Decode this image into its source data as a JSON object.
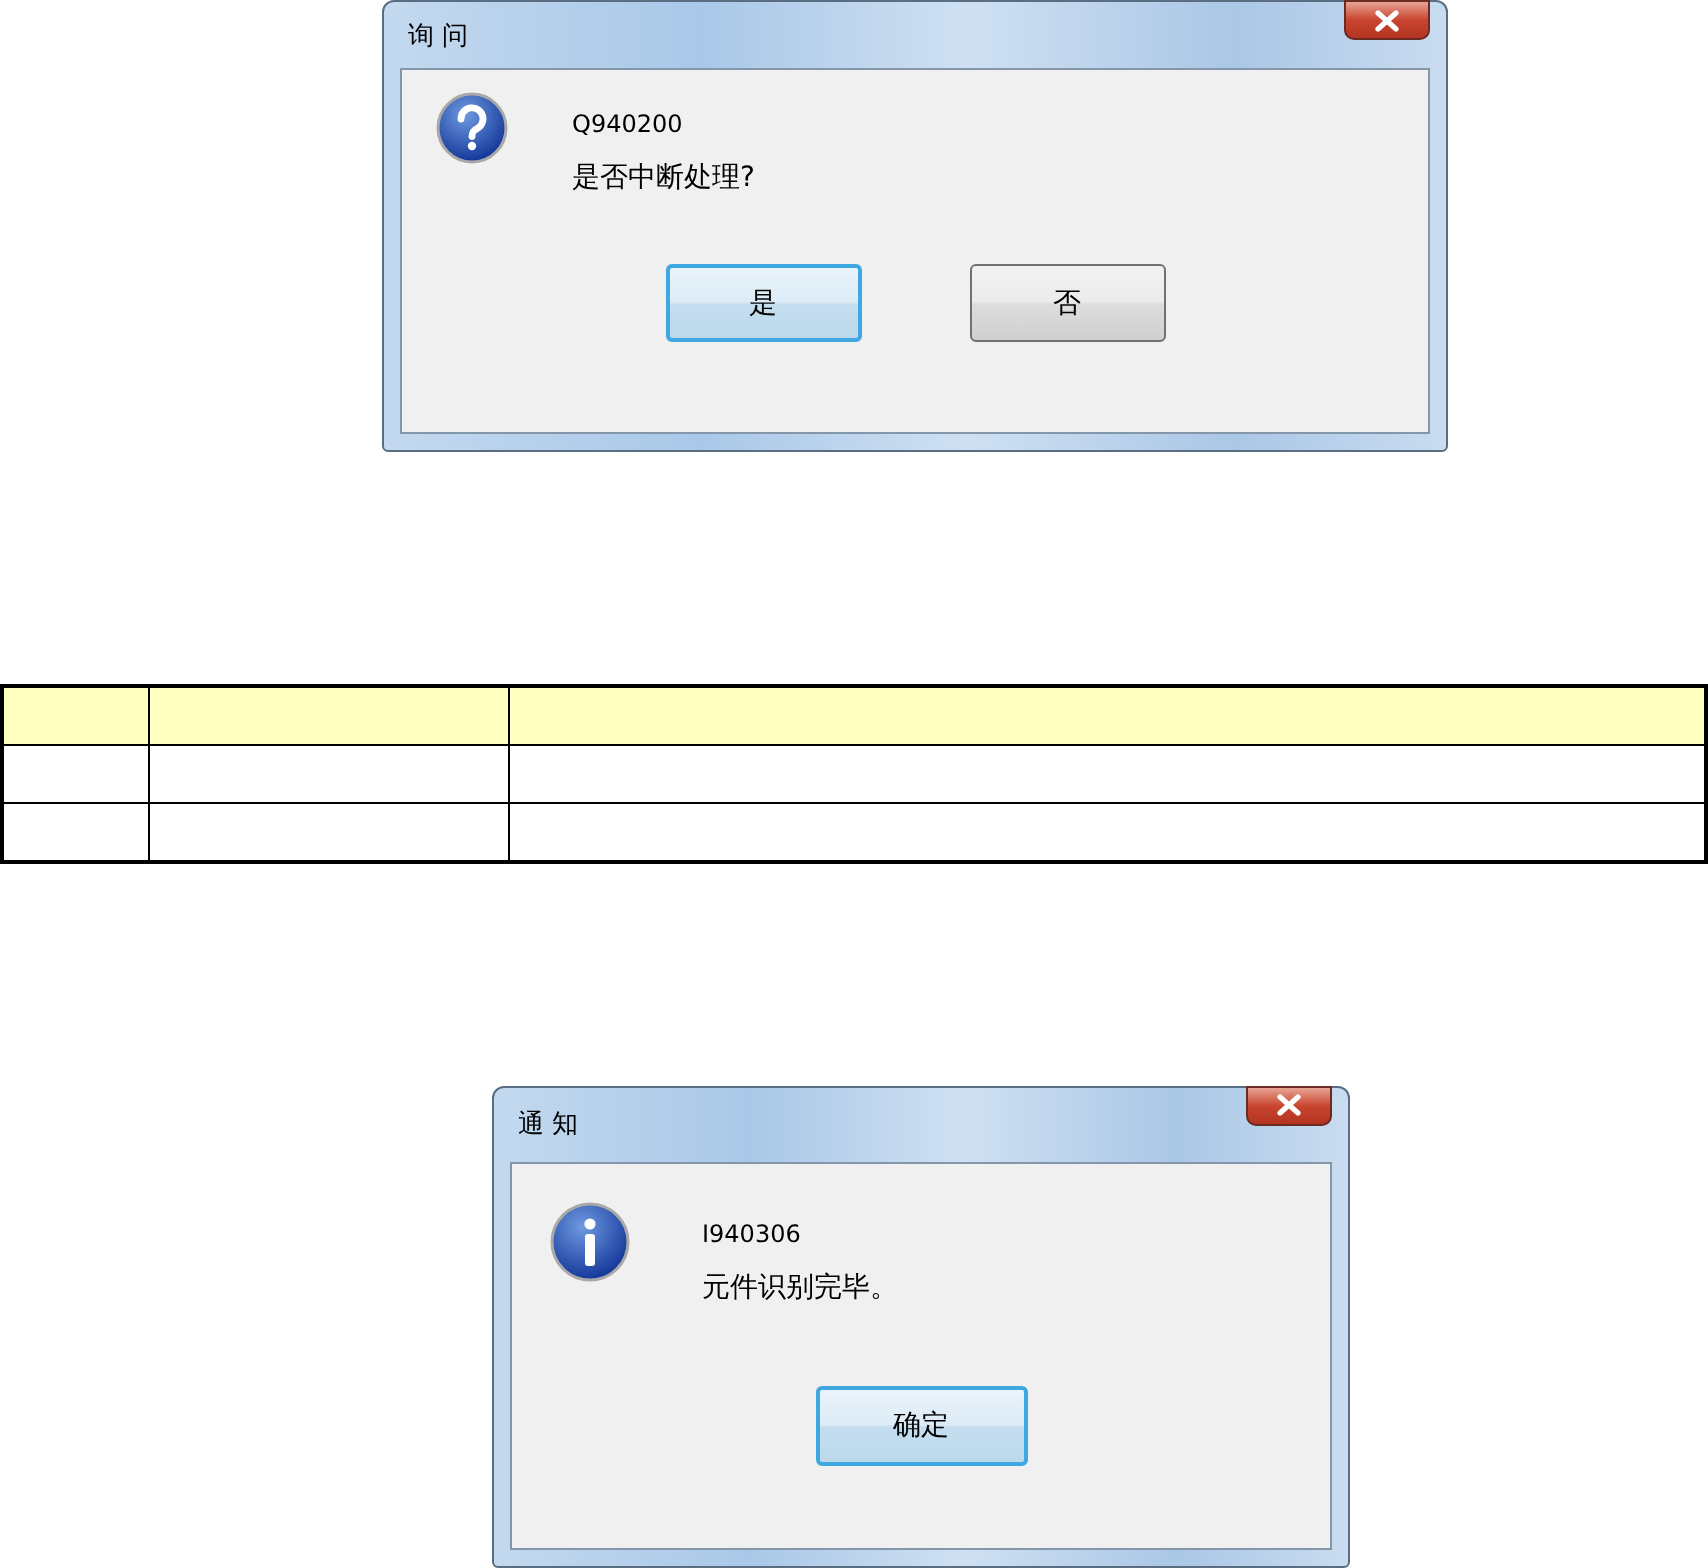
{
  "dialogs": [
    {
      "kind": "question",
      "title": "询 问",
      "code": "Q940200",
      "message": "是否中断处理?",
      "buttons": [
        {
          "label": "是",
          "default": true
        },
        {
          "label": "否",
          "default": false
        }
      ]
    },
    {
      "kind": "info",
      "title": "通 知",
      "code": "I940306",
      "message": "元件识别完毕。",
      "buttons": [
        {
          "label": "确定",
          "default": true
        }
      ]
    }
  ]
}
